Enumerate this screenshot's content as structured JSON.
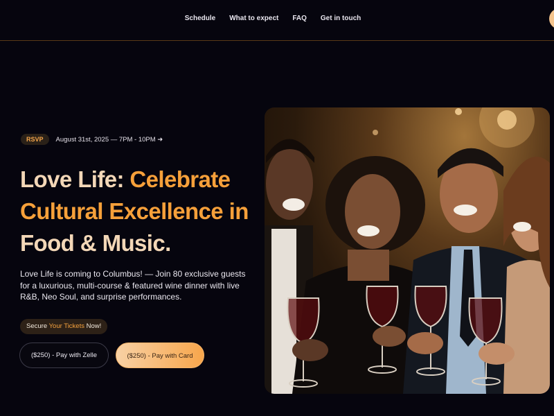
{
  "nav": {
    "links": [
      "Schedule",
      "What to expect",
      "FAQ",
      "Get in touch"
    ]
  },
  "hero": {
    "badge": "RSVP",
    "date_line": "August 31st, 2025 — 7PM - 10PM ➜",
    "headline_part1": "Love Life: ",
    "headline_part2": "Celebrate",
    "headline_line2": "Cultural Excellence in",
    "headline_line3": "Food & Music.",
    "description": "Love Life is coming to Columbus! — Join 80 exclusive guests for a luxurious, multi-course & featured wine dinner with live R&B, Neo Soul, and surprise performances.",
    "secure_pre": "Secure ",
    "secure_highlight": "Your Tickets",
    "secure_post": " Now!",
    "btn_zelle": "($250) - Pay with Zelle",
    "btn_card": "($250) - Pay with Card"
  },
  "colors": {
    "background": "#06050e",
    "accent": "#f6a03a",
    "headline_light": "#f3d7b7"
  }
}
